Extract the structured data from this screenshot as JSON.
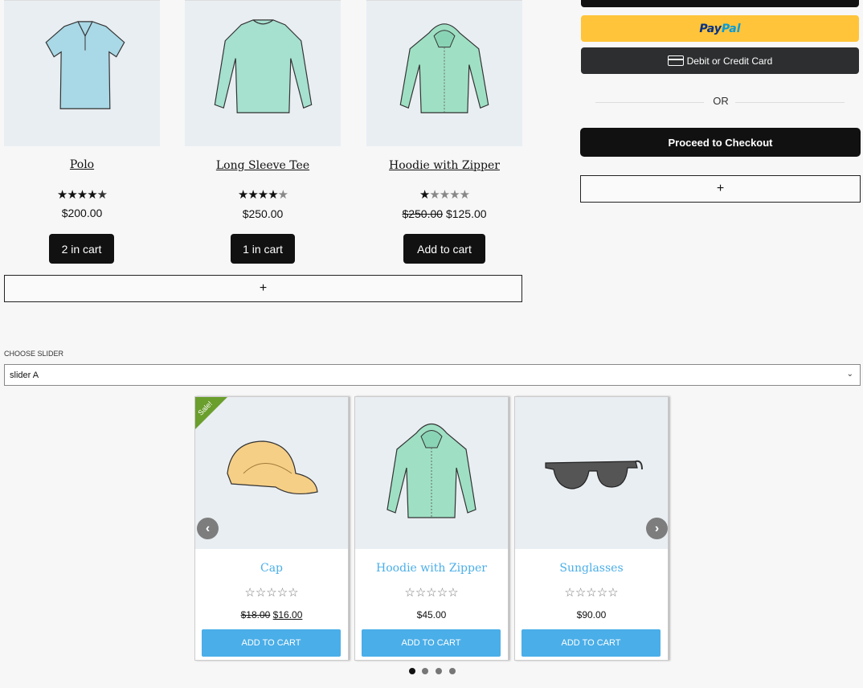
{
  "products": [
    {
      "title": "Polo",
      "rating": 4.5,
      "price": "$200.00",
      "button": "2 in cart"
    },
    {
      "title": "Long Sleeve Tee",
      "rating": 4,
      "price": "$250.00",
      "button": "1 in cart"
    },
    {
      "title": "Hoodie with Zipper",
      "rating": 1,
      "old_price": "$250.00",
      "price": "$125.00",
      "button": "Add to cart"
    }
  ],
  "add_block_symbol": "+",
  "payment": {
    "paypal_pay": "Pay",
    "paypal_pal": "Pal",
    "card_label": "Debit or Credit Card",
    "or_label": "OR",
    "checkout_label": "Proceed to Checkout",
    "add_block_symbol": "+"
  },
  "slider_select": {
    "label": "CHOOSE SLIDER",
    "value": "slider A"
  },
  "slider": {
    "items": [
      {
        "title": "Cap",
        "stars": "☆☆☆☆☆",
        "old_price": "$18.00",
        "price": "$16.00",
        "button": "ADD TO CART",
        "badge": "Sale!"
      },
      {
        "title": "Hoodie with Zipper",
        "stars": "☆☆☆☆☆",
        "price": "$45.00",
        "button": "ADD TO CART"
      },
      {
        "title": "Sunglasses",
        "stars": "☆☆☆☆☆",
        "price": "$90.00",
        "button": "ADD TO CART"
      }
    ],
    "prev_arrow": "‹",
    "next_arrow": "›",
    "dot_count": 4,
    "active_dot": 1
  },
  "colors": {
    "accent_blue": "#4aaee8",
    "paypal_yellow": "#ffc439",
    "sale_green": "#6a9e2d"
  }
}
